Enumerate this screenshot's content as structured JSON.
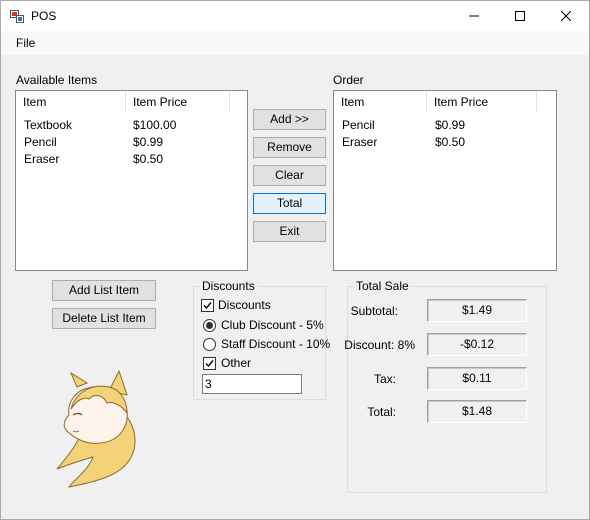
{
  "window": {
    "title": "POS"
  },
  "menu": {
    "file": "File"
  },
  "available": {
    "label": "Available Items",
    "columns": [
      "Item",
      "Item Price"
    ],
    "rows": [
      {
        "item": "Textbook",
        "price": "$100.00"
      },
      {
        "item": "Pencil",
        "price": "$0.99"
      },
      {
        "item": "Eraser",
        "price": "$0.50"
      }
    ]
  },
  "order": {
    "label": "Order",
    "columns": [
      "Item",
      "Item Price"
    ],
    "rows": [
      {
        "item": "Pencil",
        "price": "$0.99"
      },
      {
        "item": "Eraser",
        "price": "$0.50"
      }
    ]
  },
  "buttons": {
    "add": "Add >>",
    "remove": "Remove",
    "clear": "Clear",
    "total": "Total",
    "exit": "Exit",
    "add_list_item": "Add List Item",
    "delete_list_item": "Delete List Item"
  },
  "discounts": {
    "title": "Discounts",
    "discounts_check": {
      "label": "Discounts",
      "checked": true
    },
    "club": {
      "label": "Club Discount - 5%",
      "selected": true
    },
    "staff": {
      "label": "Staff Discount - 10%",
      "selected": false
    },
    "other": {
      "label": "Other",
      "checked": true
    },
    "other_value": "3"
  },
  "total_sale": {
    "title": "Total Sale",
    "subtotal_label": "Subtotal:",
    "subtotal": "$1.49",
    "discount_label": "Discount: 8%",
    "discount": "-$0.12",
    "tax_label": "Tax:",
    "tax": "$0.11",
    "total_label": "Total:",
    "total": "$1.48"
  },
  "colors": {
    "accent": "#0078d7",
    "window_bg": "#f0f0f0",
    "mascot_hair": "#f3d27a"
  },
  "icons": {
    "app": "app-icon",
    "minimize": "minimize-icon",
    "maximize": "maximize-icon",
    "close": "close-icon",
    "mascot": "pony-mascot-image"
  }
}
